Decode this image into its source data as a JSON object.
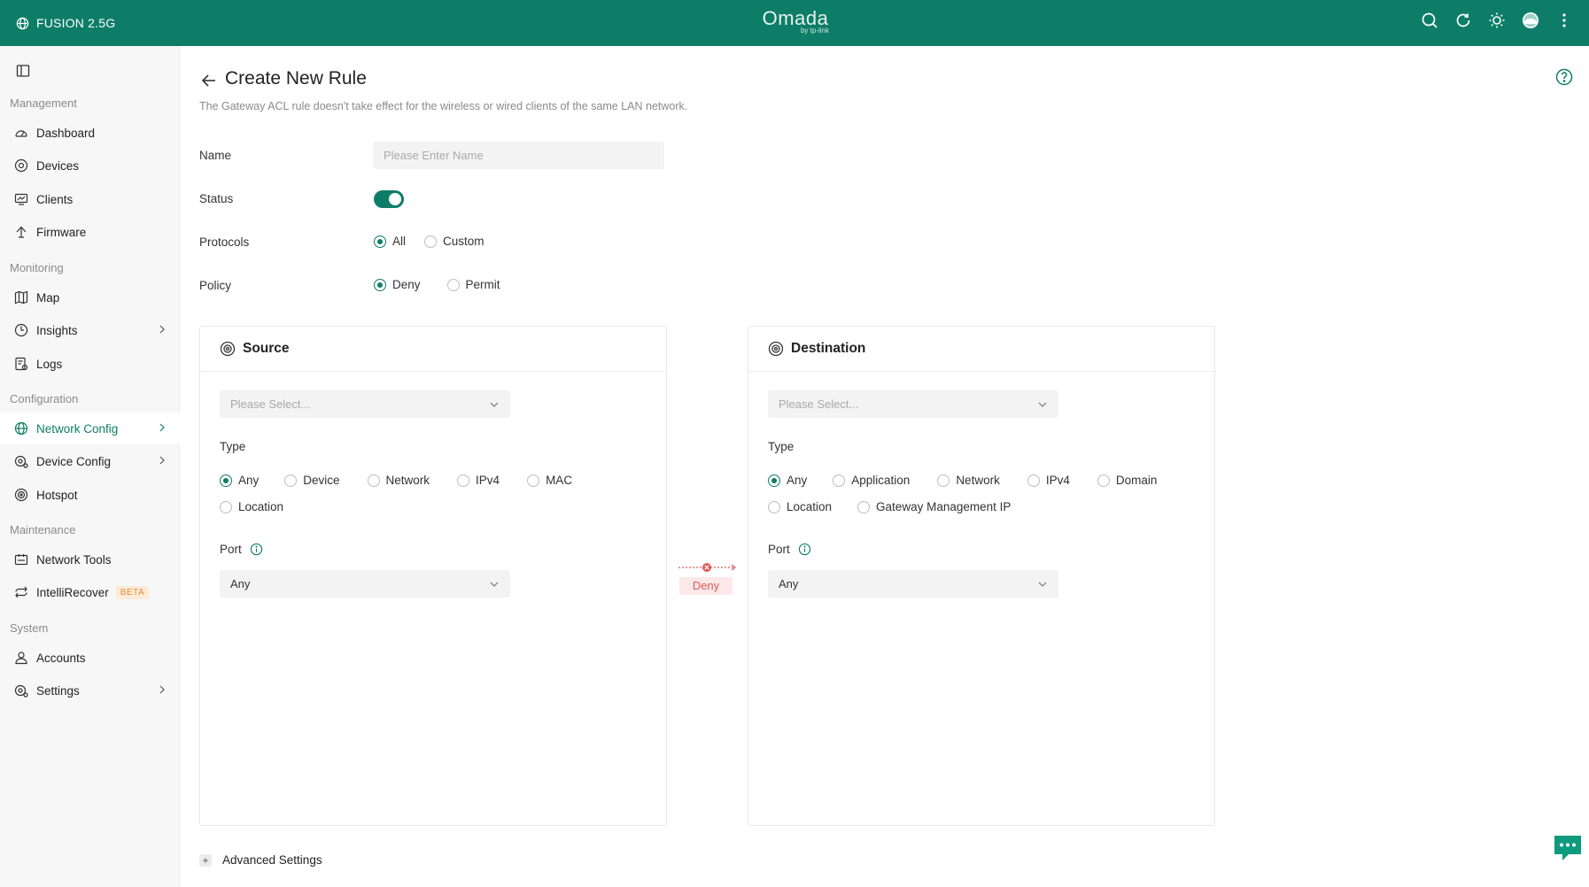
{
  "topbar": {
    "brand": "FUSION 2.5G",
    "logo": "Omada",
    "logo_sub": "by tp-link",
    "icons": [
      "search-icon",
      "refresh-icon",
      "theme-icon",
      "avatar",
      "more-icon"
    ]
  },
  "sidebar": {
    "sections": {
      "management": "Management",
      "monitoring": "Monitoring",
      "configuration": "Configuration",
      "maintenance": "Maintenance",
      "system": "System"
    },
    "items": {
      "dashboard": "Dashboard",
      "devices": "Devices",
      "clients": "Clients",
      "firmware": "Firmware",
      "map": "Map",
      "insights": "Insights",
      "logs": "Logs",
      "network_config": "Network Config",
      "device_config": "Device Config",
      "hotspot": "Hotspot",
      "network_tools": "Network Tools",
      "intellirecover": "IntelliRecover",
      "accounts": "Accounts",
      "settings": "Settings"
    },
    "beta_badge": "BETA",
    "active": "Network Config"
  },
  "page": {
    "title": "Create New Rule",
    "description": "The Gateway ACL rule doesn't take effect for the wireless or wired clients of the same LAN network."
  },
  "form": {
    "name_label": "Name",
    "name_placeholder": "Please Enter Name",
    "name_value": "",
    "status_label": "Status",
    "status_on": true,
    "protocols_label": "Protocols",
    "protocols_options": [
      "All",
      "Custom"
    ],
    "protocols_selected": "All",
    "policy_label": "Policy",
    "policy_options": [
      "Deny",
      "Permit"
    ],
    "policy_selected": "Deny"
  },
  "source": {
    "title": "Source",
    "select_placeholder": "Please Select...",
    "type_label": "Type",
    "type_options": [
      "Any",
      "Device",
      "Network",
      "IPv4",
      "MAC",
      "Location"
    ],
    "type_selected": "Any",
    "port_label": "Port",
    "port_value": "Any"
  },
  "destination": {
    "title": "Destination",
    "select_placeholder": "Please Select...",
    "type_label": "Type",
    "type_options": [
      "Any",
      "Application",
      "Network",
      "IPv4",
      "Domain",
      "Location",
      "Gateway Management IP"
    ],
    "type_selected": "Any",
    "port_label": "Port",
    "port_value": "Any"
  },
  "connector_label": "Deny",
  "advanced_settings": "Advanced Settings",
  "colors": {
    "brand": "#0e7d68",
    "deny": "#e05a5a",
    "beta": "#e58a3a"
  }
}
